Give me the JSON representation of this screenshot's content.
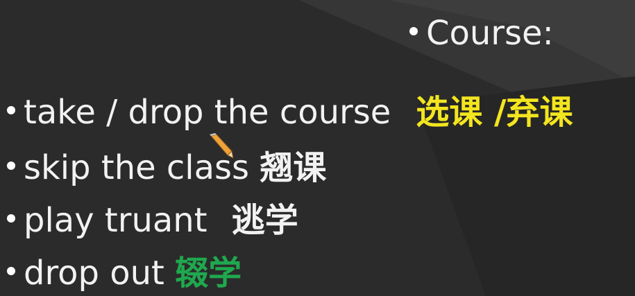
{
  "slide": {
    "heading": "Course:",
    "bullets": [
      {
        "en": "take / drop the course",
        "zh": "选课 /弃课",
        "zh_color": "#f3e51f"
      },
      {
        "en": "skip the class ",
        "zh": "翘课",
        "zh_color": "#f2f2f2"
      },
      {
        "en": "play truant ",
        "zh": "逃学",
        "zh_color": "#f2f2f2"
      },
      {
        "en": "drop out ",
        "zh": "辍学",
        "zh_color": "#1fa84e"
      }
    ]
  },
  "cursor": {
    "icon": "pencil-icon"
  }
}
